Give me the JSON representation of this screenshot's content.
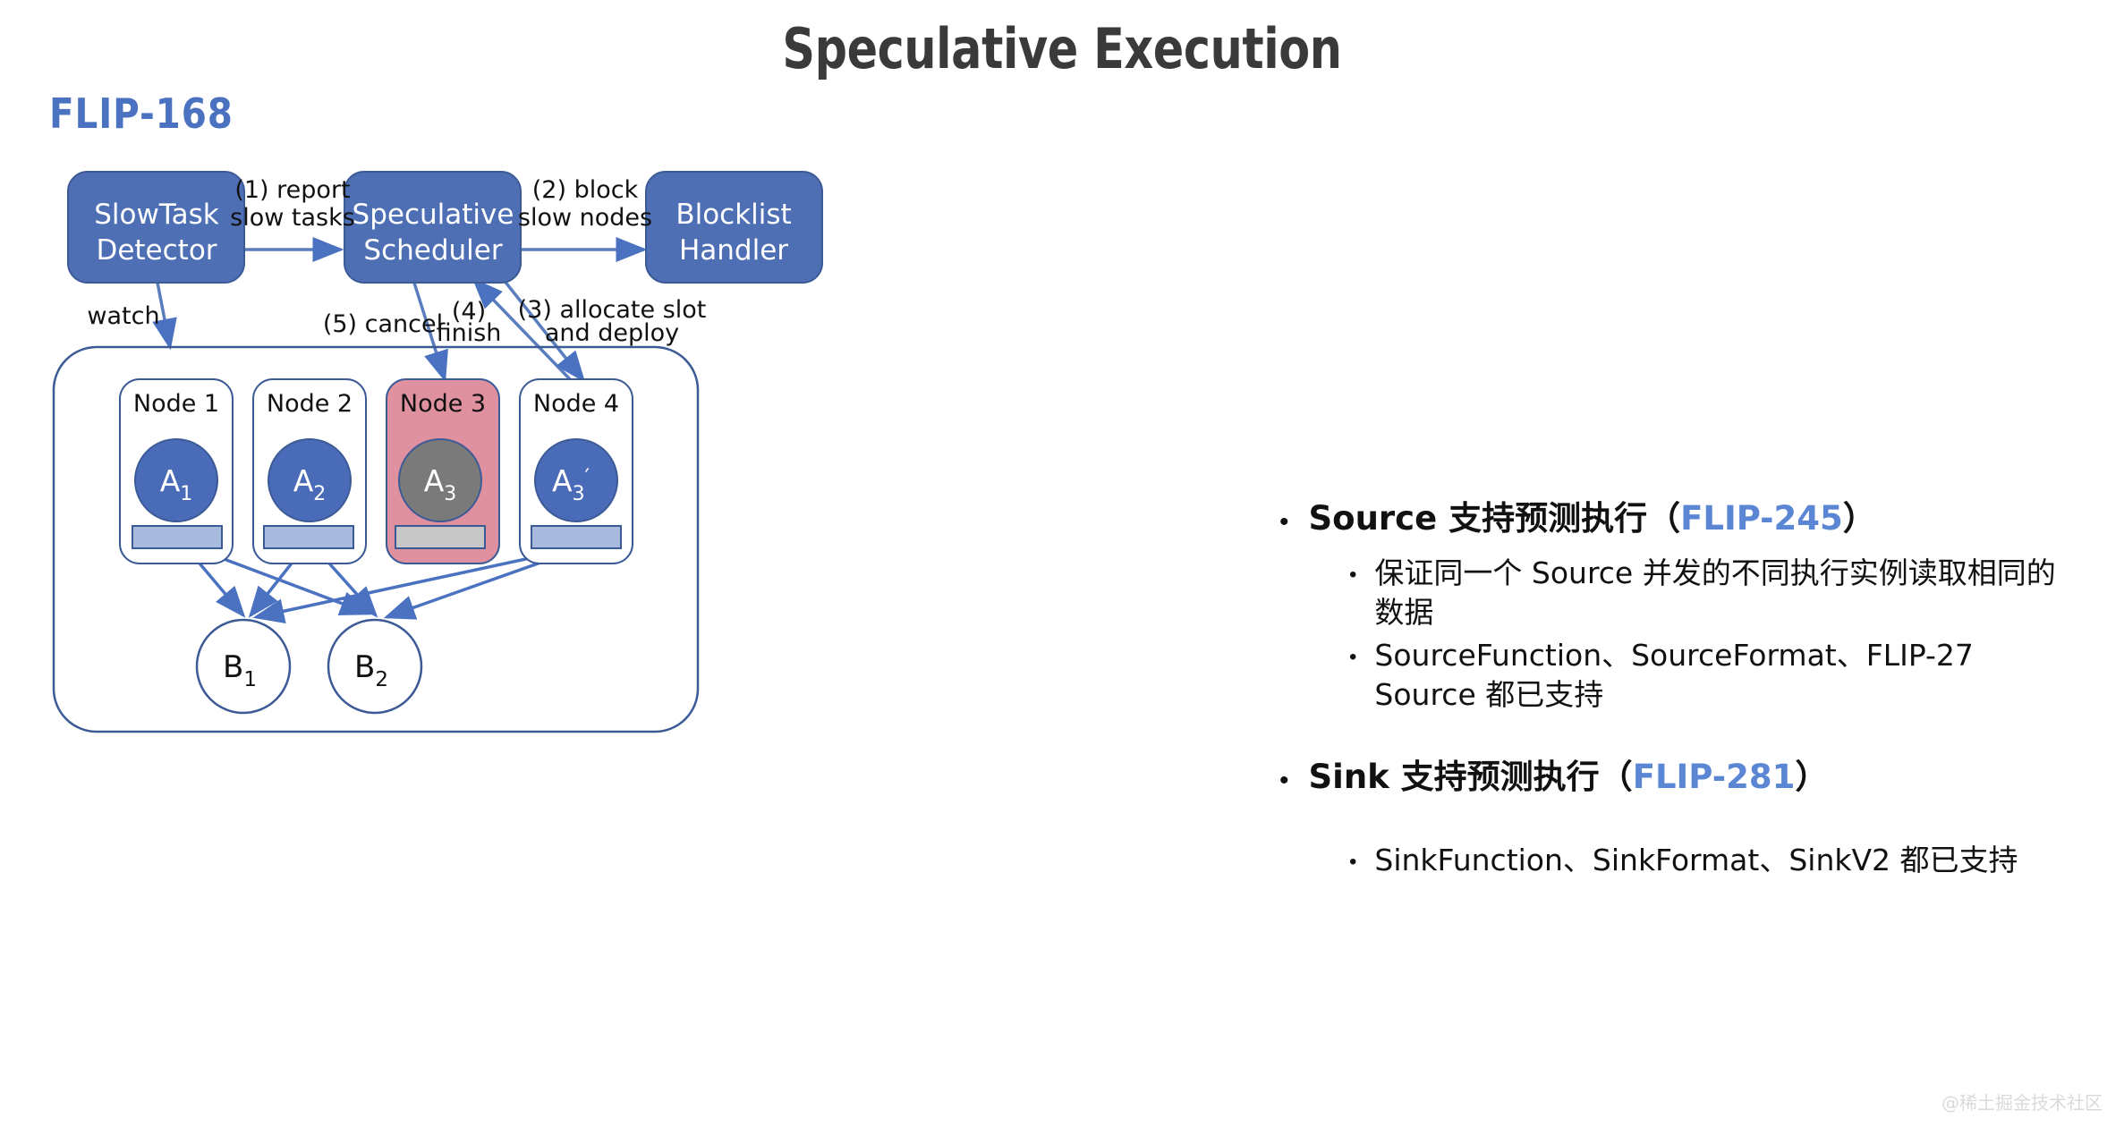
{
  "slide": {
    "title": "Speculative Execution",
    "flip_label": "FLIP-168",
    "watermark": "@稀土掘金技术社区"
  },
  "colors": {
    "box_blue": "#4f6fb5",
    "circle_blue": "#4a6cb8",
    "node3_pink": "#e0919f",
    "node3_circle_gray": "#7a7a7a",
    "slot_bar_blue": "#a8bbdf",
    "slot_bar_gray": "#c8c8c8",
    "outline_blue": "#3c5a96",
    "accent_blue": "#5b86d4",
    "title_gray": "#3a3a3a"
  },
  "diagram": {
    "boxes": [
      {
        "id": "slowtask-detector",
        "line1": "SlowTask",
        "line2": "Detector"
      },
      {
        "id": "speculative-scheduler",
        "line1": "Speculative",
        "line2": "Scheduler"
      },
      {
        "id": "blocklist-handler",
        "line1": "Blocklist",
        "line2": "Handler"
      }
    ],
    "edge_labels": [
      {
        "id": "edge-1",
        "line1": "(1) report",
        "line2": "slow tasks"
      },
      {
        "id": "edge-2",
        "line1": "(2) block",
        "line2": "slow nodes"
      },
      {
        "id": "edge-watch",
        "line1": "watch",
        "line2": ""
      },
      {
        "id": "edge-5",
        "line1": "(5) cancel",
        "line2": ""
      },
      {
        "id": "edge-4",
        "line1": "(4)",
        "line2": "finish"
      },
      {
        "id": "edge-3",
        "line1": "(3) allocate slot",
        "line2": "and deploy"
      }
    ],
    "nodes": [
      {
        "id": "node-1",
        "label": "Node 1",
        "task_main": "A",
        "task_sub": "1",
        "task_prime": "",
        "failed": false
      },
      {
        "id": "node-2",
        "label": "Node 2",
        "task_main": "A",
        "task_sub": "2",
        "task_prime": "",
        "failed": false
      },
      {
        "id": "node-3",
        "label": "Node 3",
        "task_main": "A",
        "task_sub": "3",
        "task_prime": "",
        "failed": true
      },
      {
        "id": "node-4",
        "label": "Node 4",
        "task_main": "A",
        "task_sub": "3",
        "task_prime": "′",
        "failed": false
      }
    ],
    "sinks": [
      {
        "id": "sink-b1",
        "main": "B",
        "sub": "1"
      },
      {
        "id": "sink-b2",
        "main": "B",
        "sub": "2"
      }
    ]
  },
  "bullets": [
    {
      "id": "bullet-source",
      "text_before": "Source 支持预测执行（",
      "accent": "FLIP-245",
      "text_after": "）",
      "children": [
        {
          "id": "sub-source-consistency",
          "text": "保证同一个 Source 并发的不同执行实例读取相同的数据"
        },
        {
          "id": "sub-source-support",
          "text": "SourceFunction、SourceFormat、FLIP-27 Source 都已支持"
        }
      ]
    },
    {
      "id": "bullet-sink",
      "text_before": "Sink 支持预测执行（",
      "accent": "FLIP-281",
      "text_after": "）",
      "children": [
        {
          "id": "sub-sink-support",
          "text": "SinkFunction、SinkFormat、SinkV2 都已支持"
        }
      ]
    }
  ]
}
